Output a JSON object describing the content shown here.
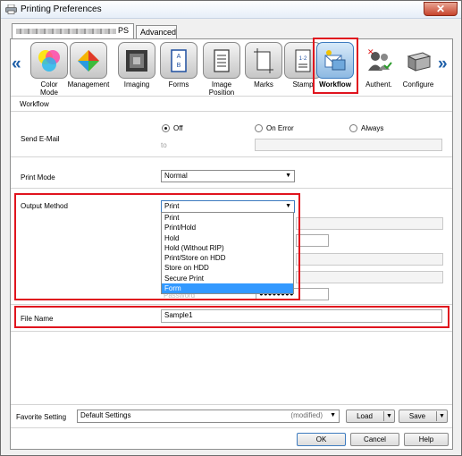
{
  "window": {
    "title": "Printing Preferences",
    "close_glyph": "✕"
  },
  "tabs": [
    {
      "label": "PS",
      "active": true
    },
    {
      "label": "Advanced",
      "active": false
    }
  ],
  "nav": {
    "left_arrow": "«",
    "right_arrow": "»",
    "features": [
      {
        "label": "Color\nMode",
        "icon": "color-mode-icon"
      },
      {
        "label": "Management",
        "icon": "management-icon"
      },
      {
        "label": "Imaging",
        "icon": "imaging-icon"
      },
      {
        "label": "Forms",
        "icon": "forms-icon"
      },
      {
        "label": "Image Position",
        "icon": "image-position-icon"
      },
      {
        "label": "Marks",
        "icon": "marks-icon"
      },
      {
        "label": "Stamp",
        "icon": "stamp-icon"
      },
      {
        "label": "Workflow",
        "icon": "workflow-icon",
        "selected": true
      },
      {
        "label": "Authent.",
        "icon": "authentication-icon"
      },
      {
        "label": "Configure",
        "icon": "configure-icon"
      }
    ]
  },
  "section_title": "Workflow",
  "send_email": {
    "label": "Send E-Mail",
    "options": [
      "Off",
      "On Error",
      "Always"
    ],
    "selected": "Off",
    "to_label": "to",
    "to_value": ""
  },
  "print_mode": {
    "label": "Print Mode",
    "value": "Normal"
  },
  "output_method": {
    "label": "Output Method",
    "value": "Print",
    "options": [
      "Print",
      "Print/Hold",
      "Hold",
      "Hold (Without RIP)",
      "Print/Store on HDD",
      "Store on HDD",
      "Secure Print",
      "Form"
    ],
    "highlighted": "Form"
  },
  "obscured": {
    "password_label": "Password",
    "password_mask": "●●●●●●●●"
  },
  "file_name": {
    "label": "File Name",
    "value": "Sample1"
  },
  "favorite": {
    "label": "Favorite Setting",
    "value": "Default Settings",
    "status": "(modified)",
    "load_label": "Load",
    "save_label": "Save"
  },
  "buttons": {
    "ok": "OK",
    "cancel": "Cancel",
    "help": "Help"
  },
  "colors": {
    "highlight_border": "#e0141e",
    "selection": "#3399ff",
    "nav_arrow": "#1e5fa8"
  }
}
